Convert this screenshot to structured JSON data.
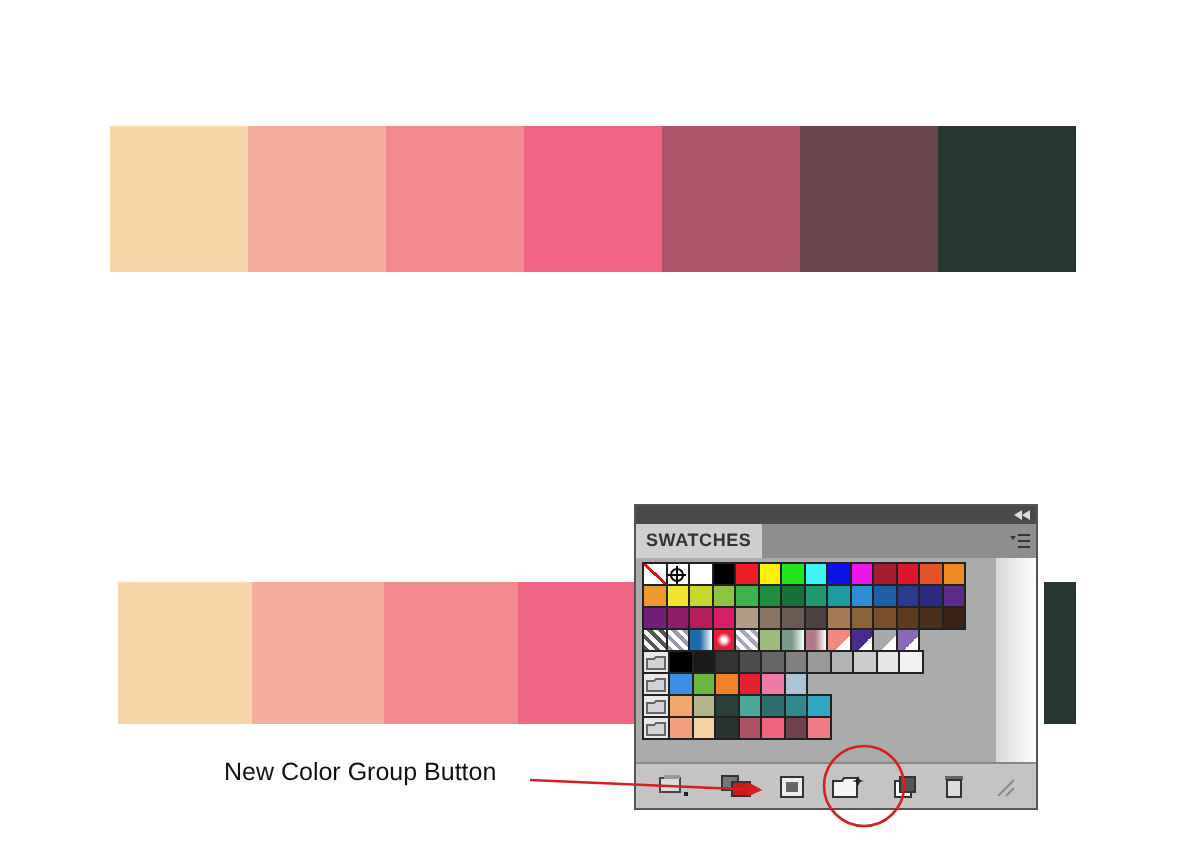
{
  "top_palette": [
    {
      "color": "#f6d5a9"
    },
    {
      "color": "#f3af9c"
    },
    {
      "color": "#f38a90"
    },
    {
      "color": "#ef6582"
    },
    {
      "color": "#ac5468"
    },
    {
      "color": "#6a464c"
    },
    {
      "color": "#283732"
    }
  ],
  "bottom_palette": {
    "left": [
      {
        "color": "#f6d5a9"
      },
      {
        "color": "#f3af9c"
      },
      {
        "color": "#f38a90"
      },
      {
        "color": "#ef6582"
      }
    ],
    "right": [
      {
        "color": "#283732"
      }
    ]
  },
  "swatches_panel": {
    "tab": "SWATCHES",
    "rows": [
      {
        "kind": "plain",
        "swatches": [
          {
            "kind": "none"
          },
          {
            "kind": "registration"
          },
          {
            "kind": "solid",
            "color": "#ffffff"
          },
          {
            "kind": "solid",
            "color": "#000000"
          },
          {
            "kind": "solid",
            "color": "#ee1c25"
          },
          {
            "kind": "solid",
            "color": "#fff200"
          },
          {
            "kind": "solid",
            "color": "#22e61c"
          },
          {
            "kind": "solid",
            "color": "#3ef5f5"
          },
          {
            "kind": "solid",
            "color": "#0a14e6"
          },
          {
            "kind": "solid",
            "color": "#ec14e6"
          },
          {
            "kind": "solid",
            "color": "#a51c30"
          },
          {
            "kind": "solid",
            "color": "#d9182d"
          },
          {
            "kind": "solid",
            "color": "#e4542a"
          },
          {
            "kind": "solid",
            "color": "#ef8a22"
          }
        ]
      },
      {
        "kind": "plain",
        "swatches": [
          {
            "kind": "solid",
            "color": "#ef9a2e"
          },
          {
            "kind": "solid",
            "color": "#f0e531"
          },
          {
            "kind": "solid",
            "color": "#c8d62e"
          },
          {
            "kind": "solid",
            "color": "#8cc63e"
          },
          {
            "kind": "solid",
            "color": "#3cb44a"
          },
          {
            "kind": "solid",
            "color": "#1e8e3e"
          },
          {
            "kind": "solid",
            "color": "#16703a"
          },
          {
            "kind": "solid",
            "color": "#1e9a6e"
          },
          {
            "kind": "solid",
            "color": "#1e9aa0"
          },
          {
            "kind": "solid",
            "color": "#2a8ed0"
          },
          {
            "kind": "solid",
            "color": "#1f5fa8"
          },
          {
            "kind": "solid",
            "color": "#2b3a8e"
          },
          {
            "kind": "solid",
            "color": "#2c2a7e"
          },
          {
            "kind": "solid",
            "color": "#5e2a8a"
          }
        ]
      },
      {
        "kind": "plain",
        "swatches": [
          {
            "kind": "solid",
            "color": "#6f1e7a"
          },
          {
            "kind": "solid",
            "color": "#8e1e6a"
          },
          {
            "kind": "solid",
            "color": "#b51e5a"
          },
          {
            "kind": "solid",
            "color": "#d81e6a"
          },
          {
            "kind": "solid",
            "color": "#b39a84"
          },
          {
            "kind": "solid",
            "color": "#8a7464"
          },
          {
            "kind": "solid",
            "color": "#6a5a52"
          },
          {
            "kind": "solid",
            "color": "#4e4240"
          },
          {
            "kind": "solid",
            "color": "#a67a52"
          },
          {
            "kind": "solid",
            "color": "#8e6238"
          },
          {
            "kind": "solid",
            "color": "#7a4e2a"
          },
          {
            "kind": "solid",
            "color": "#5e3a1e"
          },
          {
            "kind": "solid",
            "color": "#4a2e1a"
          },
          {
            "kind": "solid",
            "color": "#3a2216"
          }
        ]
      },
      {
        "kind": "plain",
        "swatches": [
          {
            "kind": "pattern",
            "color": "#555555"
          },
          {
            "kind": "pattern",
            "color": "#9a9aa8"
          },
          {
            "kind": "gradient",
            "color": "#1a6ea8"
          },
          {
            "kind": "radial",
            "color": "#e61e3a"
          },
          {
            "kind": "pattern",
            "color": "#a8a8b8"
          },
          {
            "kind": "solid",
            "color": "#9ebb7e"
          },
          {
            "kind": "gradient",
            "color": "#7a9a8a"
          },
          {
            "kind": "gradient",
            "color": "#b07a86"
          },
          {
            "kind": "spot",
            "color": "#f08a80"
          },
          {
            "kind": "spot",
            "color": "#4a2a8e"
          },
          {
            "kind": "spot",
            "color": "#a8a8a8"
          },
          {
            "kind": "spot",
            "color": "#8a6ab8"
          }
        ]
      },
      {
        "kind": "group",
        "swatches": [
          {
            "kind": "solid",
            "color": "#000000"
          },
          {
            "kind": "solid",
            "color": "#1a1a1a"
          },
          {
            "kind": "solid",
            "color": "#333333"
          },
          {
            "kind": "solid",
            "color": "#4d4d4d"
          },
          {
            "kind": "solid",
            "color": "#666666"
          },
          {
            "kind": "solid",
            "color": "#808080"
          },
          {
            "kind": "solid",
            "color": "#999999"
          },
          {
            "kind": "solid",
            "color": "#b3b3b3"
          },
          {
            "kind": "solid",
            "color": "#cccccc"
          },
          {
            "kind": "solid",
            "color": "#e6e6e6"
          },
          {
            "kind": "solid",
            "color": "#f2f2f2"
          }
        ]
      },
      {
        "kind": "group",
        "swatches": [
          {
            "kind": "solid",
            "color": "#3a8ee6"
          },
          {
            "kind": "solid",
            "color": "#6ab83e"
          },
          {
            "kind": "solid",
            "color": "#f0822a"
          },
          {
            "kind": "solid",
            "color": "#e61e2e"
          },
          {
            "kind": "solid",
            "color": "#f07aa6"
          },
          {
            "kind": "solid",
            "color": "#aec4d4"
          }
        ]
      },
      {
        "kind": "group",
        "swatches": [
          {
            "kind": "solid",
            "color": "#f2a86a"
          },
          {
            "kind": "solid",
            "color": "#b4b48a"
          },
          {
            "kind": "solid",
            "color": "#2a3e3a"
          },
          {
            "kind": "solid",
            "color": "#4aa89a"
          },
          {
            "kind": "solid",
            "color": "#2e6e6e"
          },
          {
            "kind": "solid",
            "color": "#2e8a8e"
          },
          {
            "kind": "solid",
            "color": "#2ea8c4"
          }
        ]
      },
      {
        "kind": "group",
        "swatches": [
          {
            "kind": "solid",
            "color": "#f2a080"
          },
          {
            "kind": "solid",
            "color": "#f5d2a0"
          },
          {
            "kind": "solid",
            "color": "#28342e"
          },
          {
            "kind": "solid",
            "color": "#ae5266"
          },
          {
            "kind": "solid",
            "color": "#f06480"
          },
          {
            "kind": "solid",
            "color": "#6e4248"
          },
          {
            "kind": "solid",
            "color": "#f07a86"
          }
        ]
      }
    ]
  },
  "annotation": {
    "label": "New Color Group Button"
  }
}
